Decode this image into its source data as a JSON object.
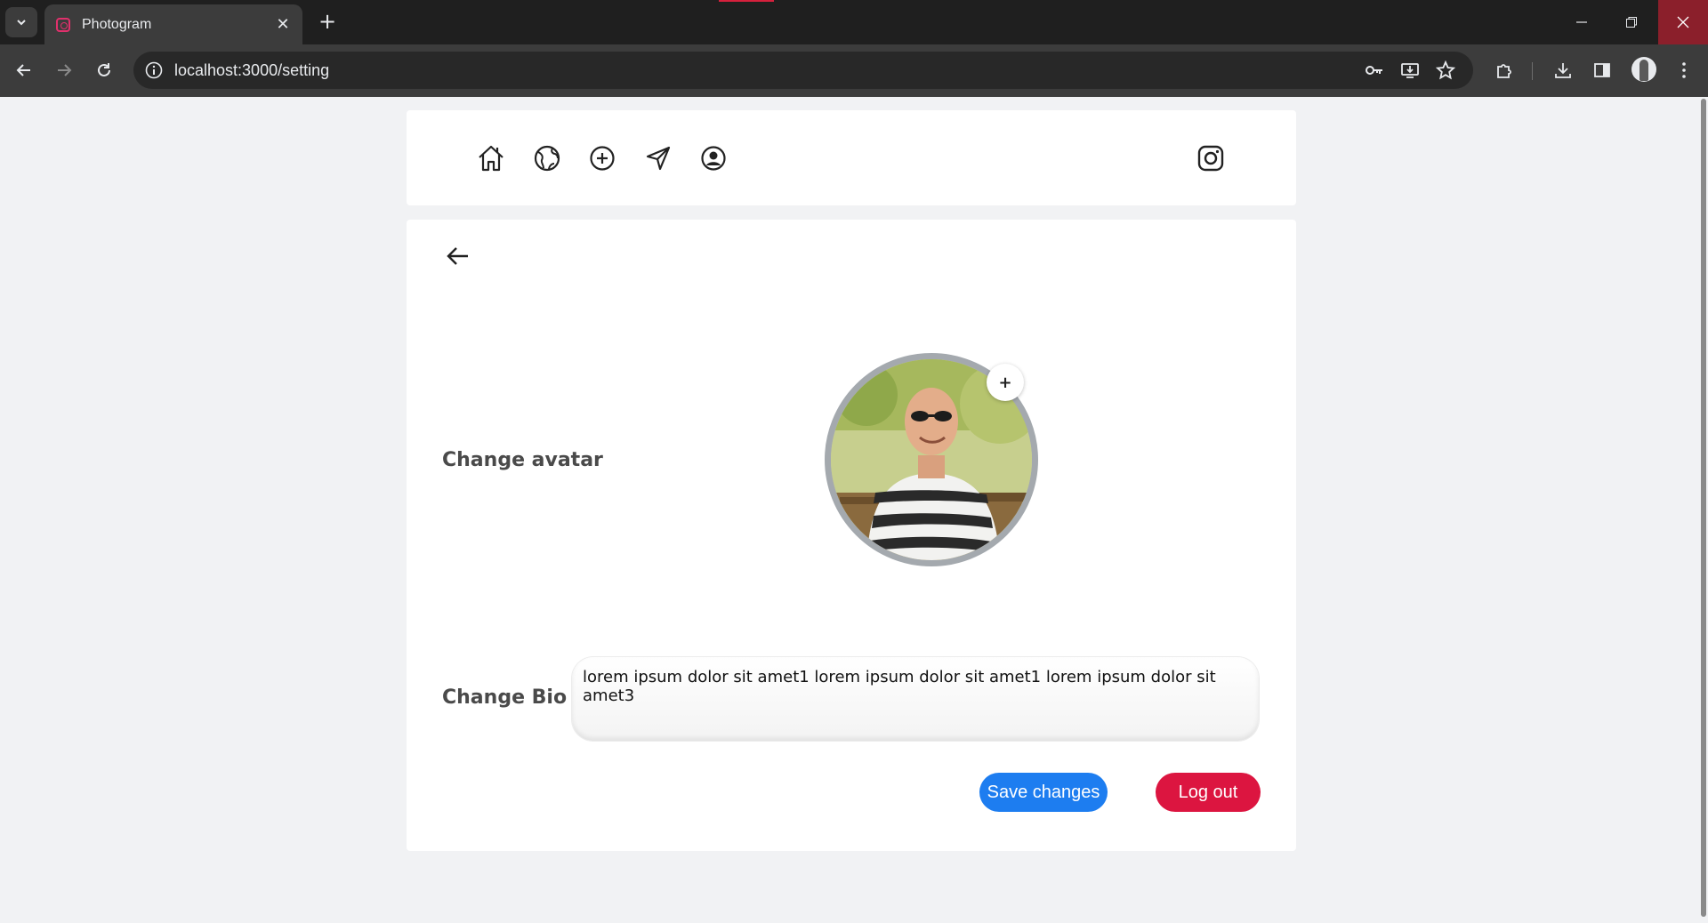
{
  "browser": {
    "tab_title": "Photogram",
    "url": "localhost:3000/setting"
  },
  "nav": {
    "items": [
      "home-icon",
      "globe-icon",
      "plus-circle-icon",
      "send-icon",
      "user-circle-icon"
    ],
    "brand_icon": "instagram-icon"
  },
  "settings": {
    "avatar_label": "Change avatar",
    "avatar_add": "+",
    "bio_label": "Change Bio",
    "bio_value": "lorem ipsum dolor sit amet1 lorem ipsum dolor sit amet1 lorem ipsum dolor sit amet3",
    "save_label": "Save changes",
    "logout_label": "Log out"
  },
  "colors": {
    "save": "#1d7df0",
    "logout": "#dc1540",
    "page_bg": "#f1f2f4"
  }
}
